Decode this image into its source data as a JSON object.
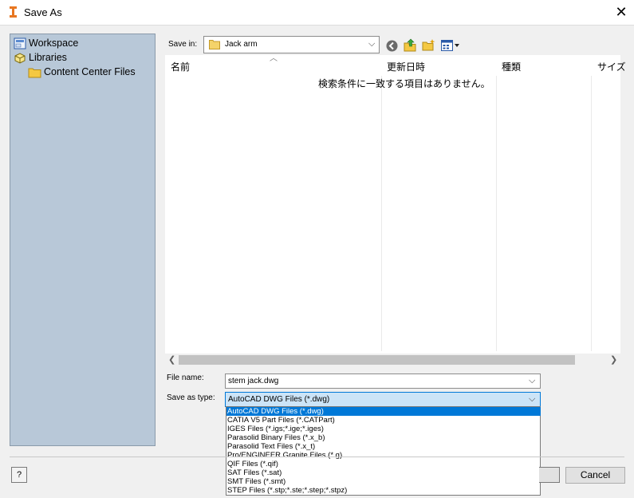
{
  "window": {
    "title": "Save As",
    "close_glyph": "✕",
    "app_icon": "inventor-icon"
  },
  "places": [
    {
      "label": "Workspace",
      "icon": "workspace-icon"
    },
    {
      "label": "Libraries",
      "icon": "libraries-icon"
    },
    {
      "label": "Content Center Files",
      "icon": "folder-icon"
    }
  ],
  "savein": {
    "label": "Save in:",
    "value": "Jack arm"
  },
  "toolbar": {
    "icons": [
      "back-icon",
      "up-folder-icon",
      "new-folder-icon",
      "view-menu-icon"
    ]
  },
  "filelist": {
    "columns": [
      "名前",
      "更新日時",
      "種類",
      "サイズ"
    ],
    "empty_message": "検索条件に一致する項目はありません。"
  },
  "filename": {
    "label": "File name:",
    "value": "stem jack.dwg"
  },
  "savetype": {
    "label": "Save as type:",
    "value": "AutoCAD DWG Files (*.dwg)",
    "options": [
      "AutoCAD DWG Files (*.dwg)",
      "CATIA V5 Part Files (*.CATPart)",
      "IGES Files (*.igs;*.ige;*.iges)",
      "Parasolid Binary Files (*.x_b)",
      "Parasolid Text Files (*.x_t)",
      "Pro/ENGINEER Granite Files (*.g)",
      "QIF Files (*.qif)",
      "SAT Files (*.sat)",
      "SMT Files (*.smt)",
      "STEP Files (*.stp;*.ste;*.step;*.stpz)"
    ],
    "selected_index": 0
  },
  "buttons": {
    "help": "?",
    "cancel": "Cancel"
  },
  "colors": {
    "places_bg": "#b8c8d8",
    "selection": "#0078d7"
  }
}
